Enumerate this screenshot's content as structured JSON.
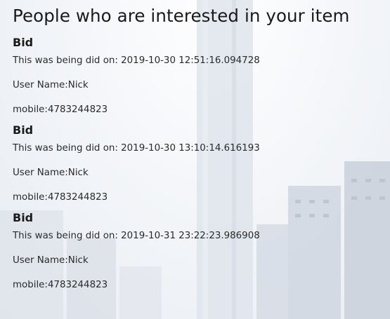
{
  "page": {
    "title": "People who are interested in your item"
  },
  "bids": [
    {
      "heading": "Bid",
      "date_prefix": "This was being did on: ",
      "date": "2019-10-30 12:51:16.094728",
      "user_prefix": "User Name:",
      "user": "Nick",
      "mobile_prefix": "mobile:",
      "mobile": "4783244823"
    },
    {
      "heading": "Bid",
      "date_prefix": "This was being did on: ",
      "date": "2019-10-30 13:10:14.616193",
      "user_prefix": "User Name:",
      "user": "Nick",
      "mobile_prefix": "mobile:",
      "mobile": "4783244823"
    },
    {
      "heading": "Bid",
      "date_prefix": "This was being did on: ",
      "date": "2019-10-31 23:22:23.986908",
      "user_prefix": "User Name:",
      "user": "Nick",
      "mobile_prefix": "mobile:",
      "mobile": "4783244823"
    }
  ]
}
